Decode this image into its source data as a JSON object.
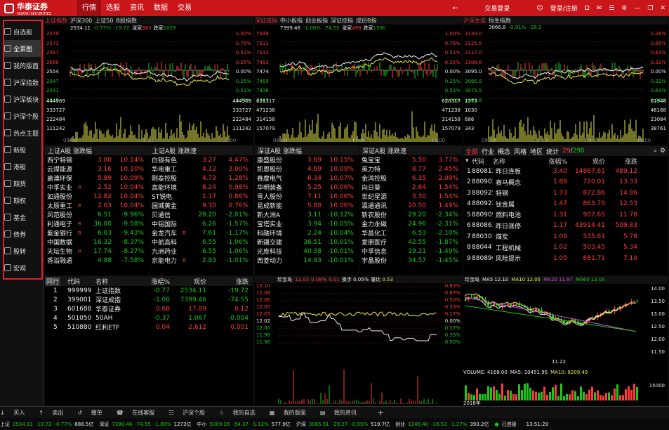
{
  "app": {
    "brand": "华泰证券",
    "brand_sub": "HUATAI SECURITIES"
  },
  "menu": [
    "行情",
    "选股",
    "资讯",
    "数据",
    "交易"
  ],
  "top_right": {
    "trade_login": "交易登录",
    "user": "登录/注册"
  },
  "sidebar": [
    "自选股",
    "全景图",
    "我的版面",
    "沪深指数",
    "沪深板块",
    "沪深个股",
    "热点主题",
    "新股",
    "港股",
    "期货",
    "期权",
    "基金",
    "债券",
    "股转",
    "宏观"
  ],
  "index_panels": [
    {
      "tabs": [
        "上证指数",
        "沪深300",
        "上证50",
        "B股指数"
      ],
      "info_val": "2534.11",
      "info_chg": "-0.77%",
      "info_pts": "-19.72",
      "up_label": "涨家",
      "up": "380",
      "down_label": "跌家",
      "down": "1029",
      "yleft": [
        "2579",
        "2573",
        "2567",
        "2560",
        "2554",
        "2547",
        "2541",
        "2535"
      ],
      "yright": [
        "1.00%",
        "0.75%",
        "0.51%",
        "0.25%",
        "0.00%",
        "0.25%",
        "0.51%",
        "0.76%"
      ],
      "vol": [
        "444969",
        "333727",
        "222484",
        "111242"
      ],
      "times": [
        "09:30",
        "11:30",
        "15:00"
      ]
    },
    {
      "tabs": [
        "深证成指",
        "中小板指",
        "创业板指",
        "深证综指",
        "成份B指"
      ],
      "info_val": "7399.46",
      "info_chg": "-1.00%",
      "info_pts": "-74.55",
      "up_label": "涨家",
      "up": "498",
      "down_label": "跌家",
      "down": "1590",
      "yleft": [
        "7549",
        "7531",
        "7512",
        "7493",
        "7474",
        "7455",
        "7436",
        "7417"
      ],
      "yright": [
        "1.00%",
        "0.76%",
        "0.51%",
        "0.25%",
        "0.00%",
        "0.25%",
        "0.51%",
        "0.76%"
      ],
      "vol": [
        "628317",
        "471238",
        "314158",
        "157079"
      ],
      "times": [
        "09:30",
        "11:30",
        "15:00"
      ]
    },
    {
      "tabs": [
        "沪深主连",
        "恒生指数"
      ],
      "info_val": "3066.8",
      "info_chg": "-0.91%",
      "info_pts": "-28.2",
      "yleft": [
        "3134.0",
        "3125.5",
        "3117.0",
        "3108.6",
        "3095.0",
        "3085.5",
        "3075.5",
        "3065.8"
      ],
      "yright": [
        "1.26%",
        "0.95%",
        "0.63%",
        "0.32%",
        "0.00%",
        "0.32%",
        "0.63%",
        "0.95%"
      ],
      "vol": [
        "1373",
        "1030",
        "686",
        "343"
      ],
      "vol_r": [
        "61948",
        "46168",
        "23084",
        "38761"
      ],
      "times": [
        "09:30",
        "11:30",
        "14:00",
        "15:00"
      ]
    }
  ],
  "movers": [
    {
      "title": "上证A股 涨跌幅",
      "rows": [
        [
          "西宁特钢",
          "3.80",
          "10.14%",
          ""
        ],
        [
          "云煤能源",
          "3.16",
          "10.10%",
          ""
        ],
        [
          "嘉澳环保",
          "5.89",
          "10.09%",
          ""
        ],
        [
          "中孚实业",
          "2.52",
          "10.04%",
          "R"
        ],
        [
          "如通股份",
          "12.82",
          "10.04%",
          ""
        ],
        [
          "太原重工",
          "2.63",
          "10.04%",
          "R"
        ],
        [
          "风范股份",
          "6.51",
          "-9.96%",
          ""
        ],
        [
          "利通电子",
          "36.80",
          "-9.58%",
          "R"
        ],
        [
          "紫金银行",
          "6.63",
          "-9.43%",
          "R"
        ],
        [
          "中国数据",
          "16.32",
          "-8.37%",
          ""
        ],
        [
          "天坛生物",
          "17.74",
          "-8.27%",
          "R"
        ],
        [
          "香溢融通",
          "4.88",
          "-7.58%",
          ""
        ]
      ]
    },
    {
      "title": "上证A股 涨跌速",
      "rows": [
        [
          "白银有色",
          "3.27",
          "4.47%",
          ""
        ],
        [
          "华电重工",
          "4.12",
          "3.00%",
          ""
        ],
        [
          "刚泰控股",
          "4.73",
          "1.28%",
          ""
        ],
        [
          "高能环境",
          "8.24",
          "0.98%",
          ""
        ],
        [
          "ST锐电",
          "1.17",
          "0.86%",
          ""
        ],
        [
          "园城黄金",
          "9.30",
          "0.76%",
          ""
        ],
        [
          "贝通信",
          "29.20",
          "-2.01%",
          ""
        ],
        [
          "中铝国际",
          "6.26",
          "-1.57%",
          ""
        ],
        [
          "金龙汽车",
          "7.61",
          "-1.17%",
          "R"
        ],
        [
          "中航高科",
          "6.55",
          "-1.06%",
          ""
        ],
        [
          "九洲药业",
          "6.55",
          "-1.06%",
          ""
        ],
        [
          "京能电力",
          "2.93",
          "-1.01%",
          "R"
        ]
      ]
    },
    {
      "title": "深证A股 涨跌幅",
      "rows": [
        [
          "康盛股份",
          "3.69",
          "10.15%",
          ""
        ],
        [
          "凯恩股份",
          "4.69",
          "10.09%",
          ""
        ],
        [
          "赛摩电气",
          "6.34",
          "10.07%",
          ""
        ],
        [
          "华明装备",
          "5.25",
          "10.06%",
          ""
        ],
        [
          "雪人股份",
          "7.11",
          "10.06%",
          ""
        ],
        [
          "易成新能",
          "5.80",
          "10.06%",
          ""
        ],
        [
          "新大洲A",
          "3.11",
          "-10.12%",
          ""
        ],
        [
          "宝塔实业",
          "3.94",
          "-10.05%",
          ""
        ],
        [
          "科融环境",
          "2.24",
          "-10.04%",
          ""
        ],
        [
          "新疆交建",
          "36.51",
          "-10.01%",
          ""
        ],
        [
          "光库科技",
          "40.38",
          "-10.01%",
          ""
        ],
        [
          "西菱动力",
          "14.93",
          "-10.01%",
          ""
        ]
      ]
    },
    {
      "title": "深证A股 涨跌速",
      "rows": [
        [
          "兔宝宝",
          "5.50",
          "3.77%",
          ""
        ],
        [
          "英力特",
          "8.77",
          "2.45%",
          ""
        ],
        [
          "金鸿控股",
          "6.35",
          "2.09%",
          ""
        ],
        [
          "向日葵",
          "2.64",
          "1.54%",
          ""
        ],
        [
          "世纪星源",
          "3.30",
          "1.54%",
          ""
        ],
        [
          "瀛通通讯",
          "20.50",
          "1.49%",
          ""
        ],
        [
          "新农股份",
          "29.20",
          "-2.34%",
          ""
        ],
        [
          "金力永磁",
          "24.96",
          "-2.31%",
          ""
        ],
        [
          "华昌化工",
          "6.53",
          "-2.10%",
          ""
        ],
        [
          "爱朋医疗",
          "42.55",
          "-1.87%",
          ""
        ],
        [
          "中孚信息",
          "19.21",
          "-1.49%",
          ""
        ],
        [
          "宇晶股份",
          "34.57",
          "-1.45%",
          ""
        ]
      ]
    }
  ],
  "sectors": {
    "tabs": [
      "全部",
      "行业",
      "概念",
      "风格",
      "地区",
      "统计"
    ],
    "page": "29",
    "total": "290",
    "headers": [
      "代码",
      "名称",
      "涨幅%",
      "现价",
      "涨跌"
    ],
    "rows": [
      [
        "1",
        "880812",
        "昨日连板",
        "3.40",
        "14867.81",
        "489.12"
      ],
      [
        "2",
        "880903",
        "赛马概念",
        "1.89",
        "720.01",
        "13.33"
      ],
      [
        "3",
        "880925",
        "特钢",
        "1.73",
        "872.86",
        "14.86"
      ],
      [
        "4",
        "880922",
        "钛金属",
        "1.47",
        "863.70",
        "12.53"
      ],
      [
        "5",
        "880909",
        "燃料电池",
        "1.31",
        "907.65",
        "11.78"
      ],
      [
        "6",
        "880863",
        "昨日涨停",
        "1.17",
        "43914.41",
        "509.83"
      ],
      [
        "7",
        "880301",
        "煤炭",
        "1.09",
        "535.61",
        "5.78"
      ],
      [
        "8",
        "880447",
        "工程机械",
        "1.02",
        "503.45",
        "5.34"
      ],
      [
        "9",
        "880896",
        "风险提示",
        "1.05",
        "681.71",
        "7.10"
      ]
    ]
  },
  "watchlist": {
    "tab": "同行",
    "headers": [
      "代码",
      "名称",
      "涨幅%",
      "现价",
      "涨跌"
    ],
    "rows": [
      [
        "1",
        "999999",
        "上证指数",
        "-0.77",
        "2534.11",
        "-19.72"
      ],
      [
        "2",
        "399001",
        "深证成指",
        "-1.00",
        "7399.46",
        "-74.55"
      ],
      [
        "3",
        "601688",
        "华泰证券",
        "0.68",
        "17.89",
        "0.12"
      ],
      [
        "4",
        "501050",
        "50AH",
        "-0.37",
        "1.067",
        "-0.004"
      ],
      [
        "5",
        "510880",
        "红利ETF",
        "0.04",
        "2.612",
        "0.001"
      ]
    ]
  },
  "intraday": {
    "name": "珍宝岛",
    "price": "12.03",
    "chg": "0.08%",
    "pts": "0.01",
    "vol_label": "量比",
    "vol": "0.53",
    "extra": "换手 0.05%",
    "yleft": [
      "12.10",
      "12.08",
      "12.06",
      "12.05",
      "12.03",
      "12.02",
      "12.00",
      "11.98",
      "11.96"
    ],
    "yright": [
      "0.83%",
      "0.67%",
      "0.50%",
      "0.33%",
      "0.17%",
      "0.00%",
      "0.17%",
      "0.33%",
      "0.50%"
    ]
  },
  "kline": {
    "name": "珍宝岛",
    "ma": [
      [
        "MA5",
        "12.10"
      ],
      [
        "MA10",
        "12.05"
      ],
      [
        "MA20",
        "11.97"
      ],
      [
        "MA60",
        "12.00"
      ]
    ],
    "yr": [
      "14.00",
      "13.50",
      "13.00",
      "12.50",
      "12.00",
      "11.50"
    ],
    "low": "11.22",
    "high": "13.70",
    "vol_text": "VOLUME: 4168.00",
    "ma5v": "MA5: 10451.95",
    "ma10v": "MA10: 8209.49",
    "vol_y": "15000",
    "date": "2018年"
  },
  "toolbar": [
    "买入",
    "卖出",
    "撤单",
    "在线客服",
    "沪深个股",
    "我的自选",
    "我的版面",
    "我的资讯"
  ],
  "status": [
    [
      "上证",
      "2534.11",
      "-19.72",
      "-0.77%",
      "888.5亿"
    ],
    [
      "深证",
      "7399.46",
      "-74.55",
      "-1.00%",
      "1273亿"
    ],
    [
      "中小",
      "5009.26",
      "-54.37",
      "-1.12%",
      "577.9亿"
    ],
    [
      "沪深",
      "3065.51",
      "-29.27",
      "-0.95%",
      "519.7亿"
    ],
    [
      "创业",
      "1245.40",
      "-16.52",
      "-1.27%",
      "393.2亿"
    ]
  ],
  "status_right": {
    "conn": "已连接",
    "time": "13:51:29"
  },
  "colors": {
    "brand": "#c9161a",
    "up": "#ff3b3b",
    "down": "#19c819"
  }
}
